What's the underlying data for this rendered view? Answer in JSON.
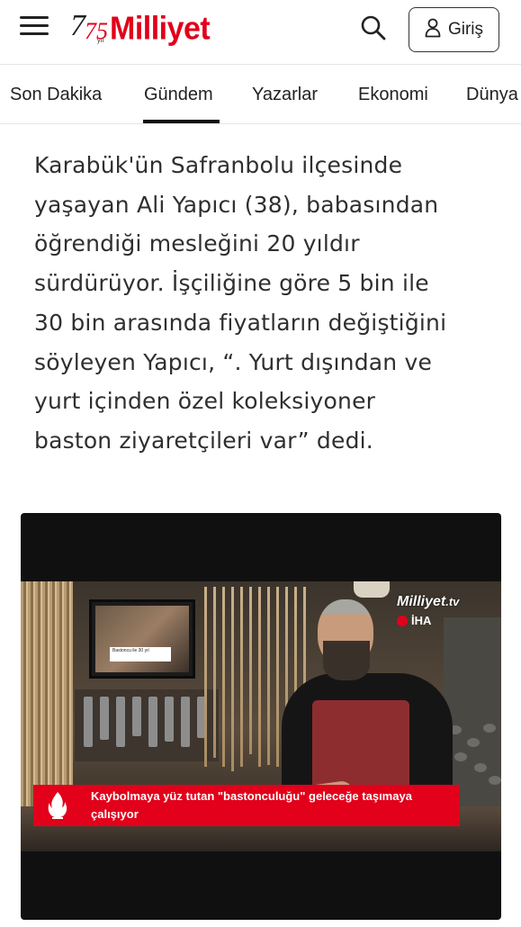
{
  "header": {
    "logo_anniversary": "75",
    "logo_anniversary_sub": "yıl",
    "logo_text": "Milliyet",
    "login_label": "Giriş",
    "icons": {
      "menu": "hamburger-icon",
      "search": "search-icon",
      "user": "user-icon"
    },
    "brand_color": "#e2001a"
  },
  "nav": {
    "items": [
      {
        "label": "Son Dakika"
      },
      {
        "label": "Gündem",
        "active": true
      },
      {
        "label": "Yazarlar"
      },
      {
        "label": "Ekonomi"
      },
      {
        "label": "Dünya"
      }
    ]
  },
  "article": {
    "lines": [
      "Karabük'ün Safranbolu ilçesinde",
      "yaşayan Ali Yapıcı (38), babasından",
      "öğrendiği mesleğini 20 yıldır",
      "sürdürüyor. İşçiliğine göre 5 bin ile",
      "30 bin arasında fiyatların değiştiğini",
      "söyleyen Yapıcı, “. Yurt dışından ve",
      "yurt içinden özel koleksiyoner",
      "baston ziyaretçileri var” dedi."
    ]
  },
  "video": {
    "watermark_brand": "Milliyet",
    "watermark_suffix": ".tv",
    "watermark_agency": "İHA",
    "caption": "Kaybolmaya yüz tutan \"bastonculuğu\" geleceğe taşımaya çalışıyor",
    "caption_icon": "flame-icon",
    "tv_caption": "Bastoncu ile 30 yıl"
  }
}
